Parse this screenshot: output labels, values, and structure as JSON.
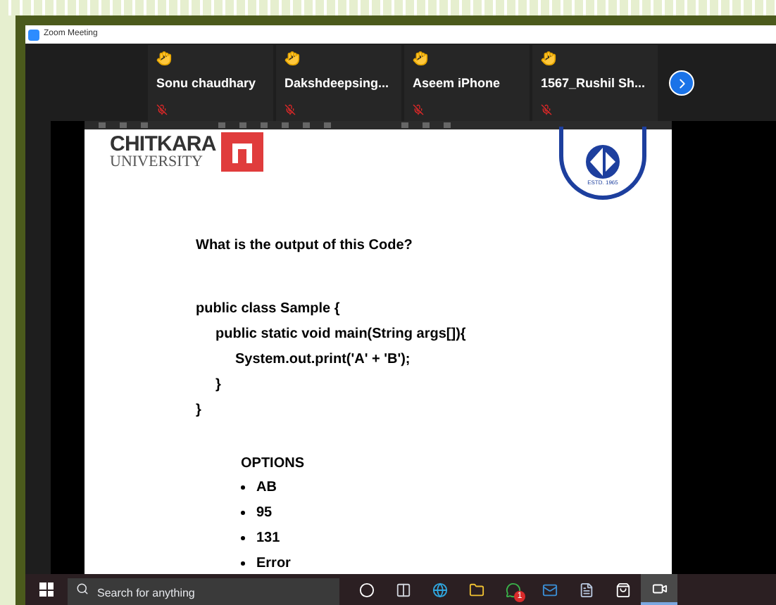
{
  "window": {
    "title": "Zoom Meeting"
  },
  "participants": [
    {
      "name": "Sonu chaudhary",
      "hand_raised": true,
      "muted": true
    },
    {
      "name": "Dakshdeepsing...",
      "hand_raised": true,
      "muted": true
    },
    {
      "name": "Aseem iPhone",
      "hand_raised": true,
      "muted": true
    },
    {
      "name": "1567_Rushil  Sh...",
      "hand_raised": true,
      "muted": true
    }
  ],
  "slide": {
    "logo_name": "CHITKARA",
    "logo_subtitle": "UNIVERSITY",
    "seal_text": "ESTD. 1965",
    "question": "What is the output of this Code?",
    "code": [
      {
        "text": "public class Sample {",
        "children": [
          {
            "text": "public static void main(String args[]){",
            "children": [
              {
                "text": "System.out.print('A' + 'B');"
              }
            ]
          },
          {
            "text": "}"
          }
        ]
      },
      {
        "text": "}"
      }
    ],
    "options_heading": "OPTIONS",
    "options": [
      "AB",
      "95",
      "131",
      "Error"
    ]
  },
  "taskbar": {
    "search": {
      "placeholder": "Search for anything"
    },
    "apps": [
      {
        "kind": "cortana",
        "selected": false
      },
      {
        "kind": "taskview",
        "selected": false
      },
      {
        "kind": "browser",
        "selected": false
      },
      {
        "kind": "folder",
        "selected": false
      },
      {
        "kind": "chat",
        "selected": false,
        "badge": "1"
      },
      {
        "kind": "mail",
        "selected": false
      },
      {
        "kind": "notes",
        "selected": false
      },
      {
        "kind": "store",
        "selected": false
      },
      {
        "kind": "video",
        "selected": true
      }
    ]
  }
}
